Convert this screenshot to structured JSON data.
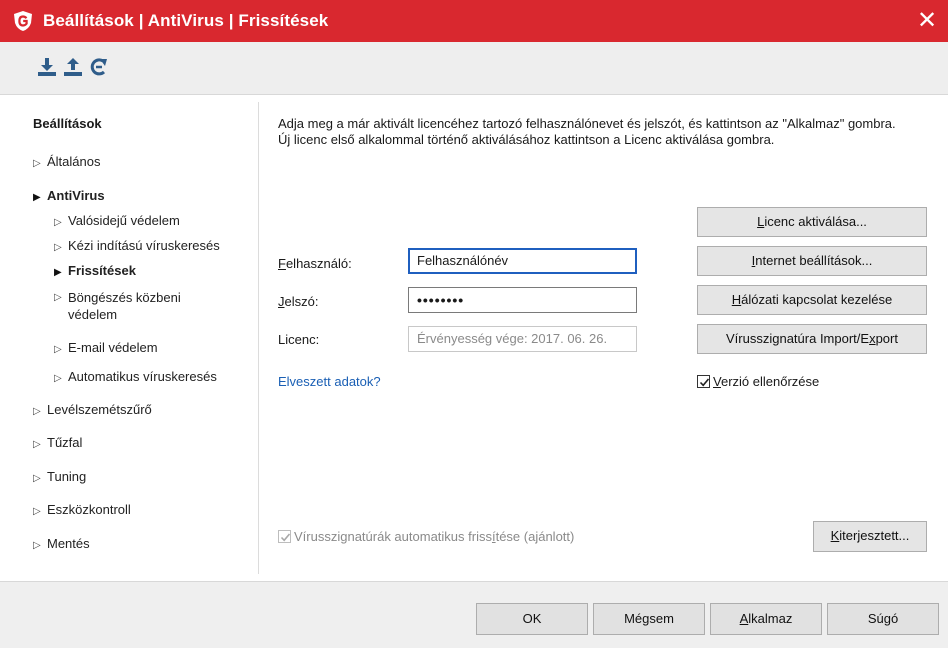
{
  "window": {
    "title": "Beállítások | AntiVirus | Frissítések",
    "close_glyph": "✕",
    "logo_icon": "gdata-shield-icon",
    "accent_color": "#d9282f"
  },
  "toolbar": {
    "icons": [
      "import-icon",
      "export-icon",
      "reset-icon"
    ]
  },
  "sidebar": {
    "heading": "Beállítások",
    "arrow_closed": "▷",
    "arrow_open": "▶",
    "items": [
      {
        "label": "Általános"
      },
      {
        "label": "AntiVirus"
      },
      {
        "label": "Valósidejű védelem"
      },
      {
        "label": "Kézi indítású víruskeresés"
      },
      {
        "label": "Frissítések"
      },
      {
        "label": "Böngészés közbeni védelem"
      },
      {
        "label": "E-mail védelem"
      },
      {
        "label": "Automatikus víruskeresés"
      },
      {
        "label": "Levélszemétszűrő"
      },
      {
        "label": "Tűzfal"
      },
      {
        "label": "Tuning"
      },
      {
        "label": "Eszközkontroll"
      },
      {
        "label": "Mentés"
      }
    ]
  },
  "main": {
    "intro_line1": "Adja meg a már aktivált licencéhez tartozó felhasználónevet és jelszót, és kattintson az \"Alkalmaz\" gombra.",
    "intro_line2": "Új licenc első alkalommal történő aktiválásához kattintson a Licenc aktiválása gombra.",
    "user_label_key": "F",
    "user_label_rest": "elhasználó:",
    "user_value": "Felhasználónév",
    "password_label_key": "J",
    "password_label_rest": "elszó:",
    "password_value": "••••••••",
    "license_label": "Licenc:",
    "license_placeholder": "Érvényesség vége: 2017. 06. 26.",
    "lost_data_link": "Elveszett adatok?",
    "auto_update_label_pre": "Vírusszignatúrák automatikus friss",
    "auto_update_label_key": "í",
    "auto_update_label_post": "tése (ajánlott)",
    "auto_update_checked": true,
    "version_check_key": "V",
    "version_check_rest": "erzió ellenőrzése",
    "version_check_checked": true
  },
  "buttons": {
    "activate_key": "L",
    "activate_rest": "icenc aktiválása...",
    "internet_key": "I",
    "internet_rest": "nternet beállítások...",
    "network_key": "H",
    "network_rest": "álózati kapcsolat kezelése",
    "import_pre": "Vírusszignatúra Import/E",
    "import_key": "x",
    "import_post": "port",
    "extended_key": "K",
    "extended_rest": "iterjesztett..."
  },
  "footer": {
    "ok": "OK",
    "cancel": "Mégsem",
    "apply_key": "A",
    "apply_rest": "lkalmaz",
    "help": "Súgó"
  }
}
